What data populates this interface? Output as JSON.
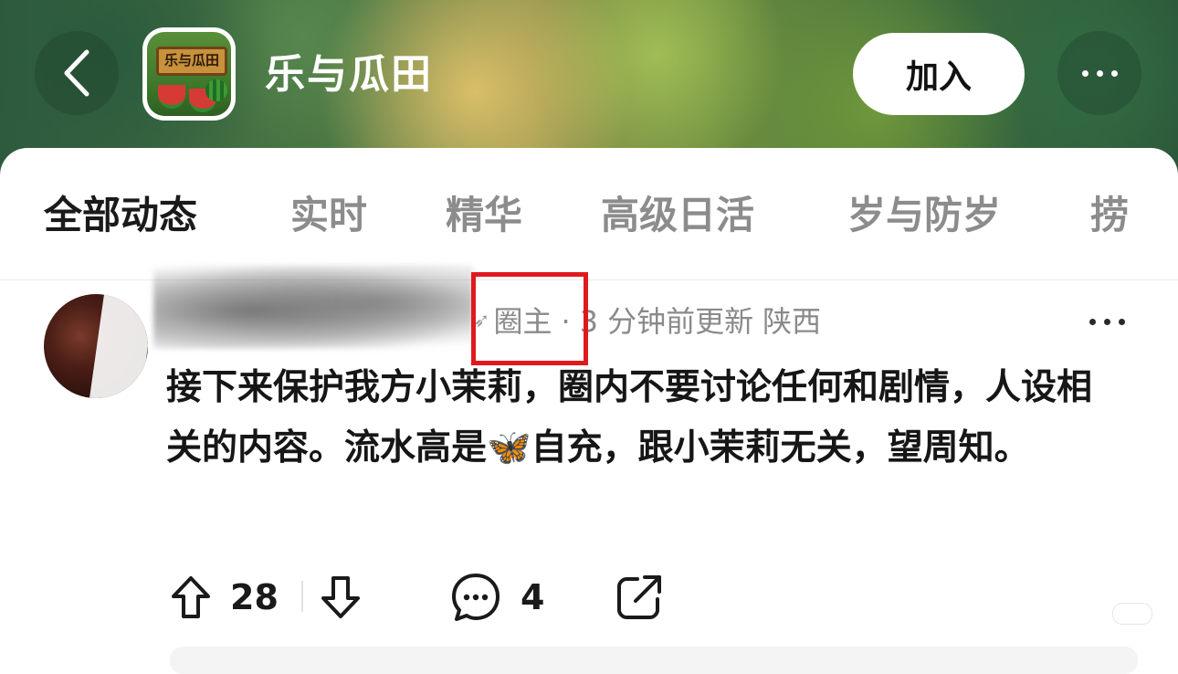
{
  "header": {
    "group_title": "乐与瓜田",
    "group_avatar_text": "乐与瓜田",
    "join_label": "加入"
  },
  "tabs": [
    {
      "label": "全部动态",
      "active": true
    },
    {
      "label": "实时",
      "active": false
    },
    {
      "label": "精华",
      "active": false
    },
    {
      "label": "高级日活",
      "active": false
    },
    {
      "label": "岁与防岁",
      "active": false
    },
    {
      "label": "捞",
      "active": false
    }
  ],
  "post": {
    "role": "圈主",
    "separator": "·",
    "time": "3 分钟前更新",
    "location": "陕西",
    "text_part1": "接下来保护我方小茉莉，圈内不要讨论任何和剧情，人设相关的内容。流水高是",
    "emoji": "🦋",
    "text_part2": "自充，跟小茉莉无关，望周知。",
    "upvotes": "28",
    "comments": "4"
  },
  "icons": {
    "back": "back-chevron-icon",
    "more": "more-dots-icon",
    "upvote": "upvote-arrow-icon",
    "downvote": "downvote-arrow-icon",
    "comment": "comment-bubble-icon",
    "share": "share-icon"
  },
  "colors": {
    "highlight": "#e0191e",
    "text_primary": "#161616",
    "text_secondary": "#8a8a8a"
  }
}
